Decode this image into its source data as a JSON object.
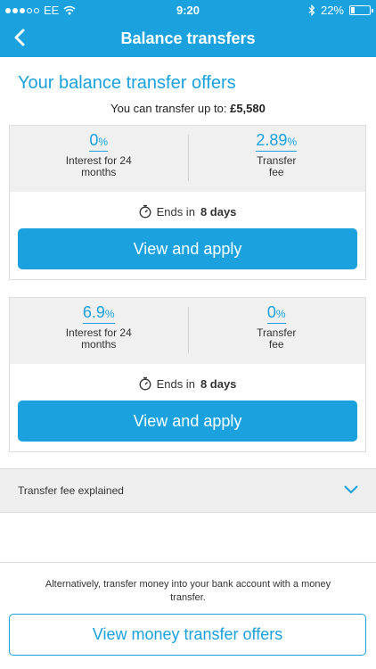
{
  "status_bar": {
    "carrier": "EE",
    "time": "9:20",
    "battery": "22%",
    "battery_level": 0.22
  },
  "nav": {
    "title": "Balance transfers"
  },
  "page": {
    "heading": "Your balance transfer offers",
    "limit_label": "You can transfer up to:",
    "limit_value": "£5,580"
  },
  "offers": [
    {
      "interest_value": "0",
      "interest_unit": "%",
      "interest_label": "Interest for 24 months",
      "fee_value": "2.89",
      "fee_unit": "%",
      "fee_label": "Transfer fee",
      "ends_prefix": "Ends in",
      "ends_value": "8 days",
      "button_label": "View and apply"
    },
    {
      "interest_value": "6.9",
      "interest_unit": "%",
      "interest_label": "Interest for 24 months",
      "fee_value": "0",
      "fee_unit": "%",
      "fee_label": "Transfer fee",
      "ends_prefix": "Ends in",
      "ends_value": "8 days",
      "button_label": "View and apply"
    }
  ],
  "explained": {
    "label": "Transfer fee explained"
  },
  "footer": {
    "text": "Alternatively, transfer money into your bank account with a money transfer.",
    "button_label": "View money transfer offers"
  },
  "colors": {
    "brand": "#1aa1de",
    "panel": "#f0f0f0"
  },
  "icons": [
    "signal-icon",
    "wifi-icon",
    "bluetooth-icon",
    "battery-icon",
    "back-chevron-icon",
    "stopwatch-icon",
    "chevron-down-icon"
  ]
}
